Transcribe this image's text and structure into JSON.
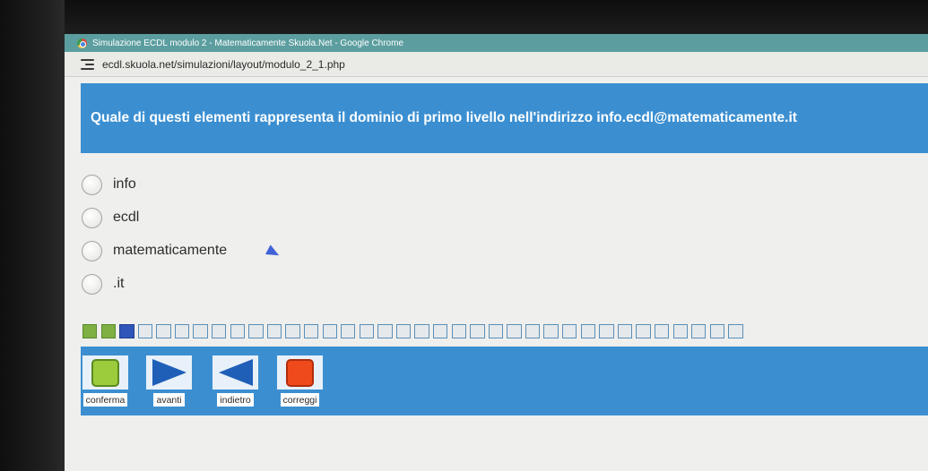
{
  "window": {
    "title": "Simulazione ECDL modulo 2 - Matematicamente Skuola.Net - Google Chrome",
    "url": "ecdl.skuola.net/simulazioni/layout/modulo_2_1.php"
  },
  "question": {
    "text": "Quale di questi elementi rappresenta il dominio di primo livello nell'indirizzo info.ecdl@matematicamente.it"
  },
  "options": [
    {
      "label": "info"
    },
    {
      "label": "ecdl"
    },
    {
      "label": "matematicamente"
    },
    {
      "label": ".it"
    }
  ],
  "progress": {
    "total": 36,
    "completed": 2,
    "current_index": 3
  },
  "toolbar": {
    "confirm_label": "conferma",
    "forward_label": "avanti",
    "back_label": "indietro",
    "correct_label": "correggi"
  },
  "icons": {
    "confirm": "green-square-icon",
    "forward": "play-right-icon",
    "back": "play-left-icon",
    "correct": "red-square-icon"
  },
  "colors": {
    "accent_blue": "#3b8fd1",
    "titlebar_teal": "#5c9ea0",
    "progress_done": "#7eb043",
    "progress_current": "#2f56b8"
  }
}
